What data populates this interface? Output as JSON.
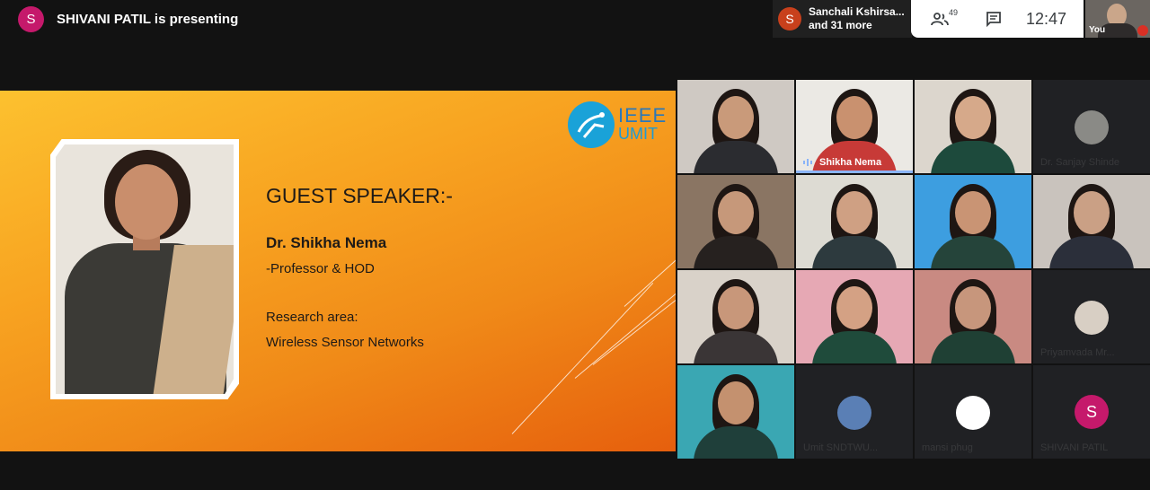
{
  "topbar": {
    "presenter_initial": "S",
    "presenter_text": "SHIVANI PATIL is presenting",
    "participants_initial": "S",
    "participants_line1": "Sanchali Kshirsa...",
    "participants_line2": "and 31 more",
    "people_count": "49",
    "time": "12:47",
    "self_label": "You"
  },
  "slide": {
    "logo_line1": "IEEE",
    "logo_line2": "UMIT",
    "title": "GUEST SPEAKER:-",
    "name": "Dr. Shikha Nema",
    "role": "-Professor & HOD",
    "area_label": "Research area:",
    "area_value": "Wireless Sensor Networks"
  },
  "tiles": [
    {
      "name": ""
    },
    {
      "name": "Shikha Nema"
    },
    {
      "name": ""
    },
    {
      "name": "Dr. Sanjay Shinde"
    },
    {
      "name": ""
    },
    {
      "name": ""
    },
    {
      "name": ""
    },
    {
      "name": ""
    },
    {
      "name": ""
    },
    {
      "name": ""
    },
    {
      "name": ""
    },
    {
      "name": "Priyamvada Mr..."
    },
    {
      "name": ""
    },
    {
      "name": "Umit SNDTWU..."
    },
    {
      "name": "mansi phug"
    },
    {
      "name": "SHIVANI PATIL",
      "initial": "S"
    }
  ]
}
